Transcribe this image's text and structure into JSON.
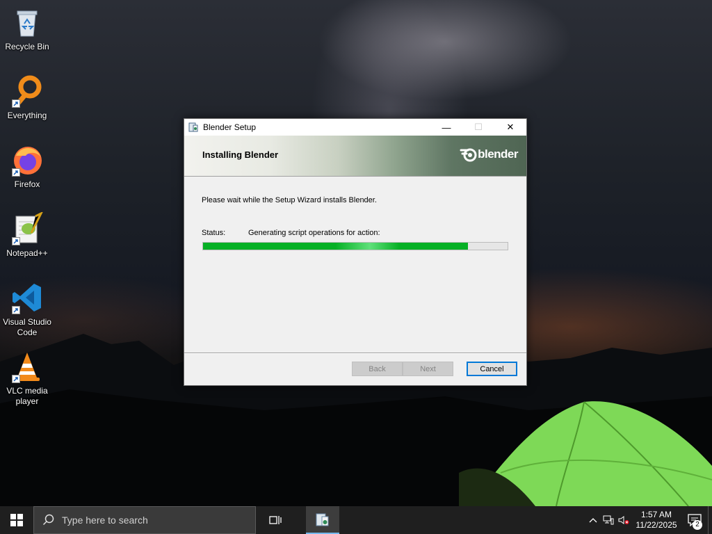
{
  "desktop": {
    "icons": [
      {
        "label": "Recycle Bin",
        "icon": "recycle-bin-icon"
      },
      {
        "label": "Everything",
        "icon": "everything-search-icon"
      },
      {
        "label": "Firefox",
        "icon": "firefox-icon"
      },
      {
        "label": "Notepad++",
        "icon": "notepad-plus-plus-icon"
      },
      {
        "label": "Visual Studio Code",
        "icon": "vscode-icon"
      },
      {
        "label": "VLC media player",
        "icon": "vlc-icon"
      }
    ]
  },
  "dialog": {
    "title": "Blender Setup",
    "heading": "Installing Blender",
    "logo_text": "blender",
    "message": "Please wait while the Setup Wizard installs Blender.",
    "status_label": "Status:",
    "status_text": "Generating script operations for action:",
    "progress": 0.87,
    "buttons": {
      "back": "Back",
      "next": "Next",
      "cancel": "Cancel"
    },
    "window_controls": {
      "minimize": "—",
      "maximize": "☐",
      "close": "✕"
    }
  },
  "taskbar": {
    "search_placeholder": "Type here to search",
    "clock_time": "1:57 AM",
    "clock_date": "11/22/2025",
    "notification_count": "2"
  },
  "colors": {
    "progress_fill": "#06b025",
    "taskbar_bg": "#1f1f1f",
    "accent": "#0078d7"
  }
}
